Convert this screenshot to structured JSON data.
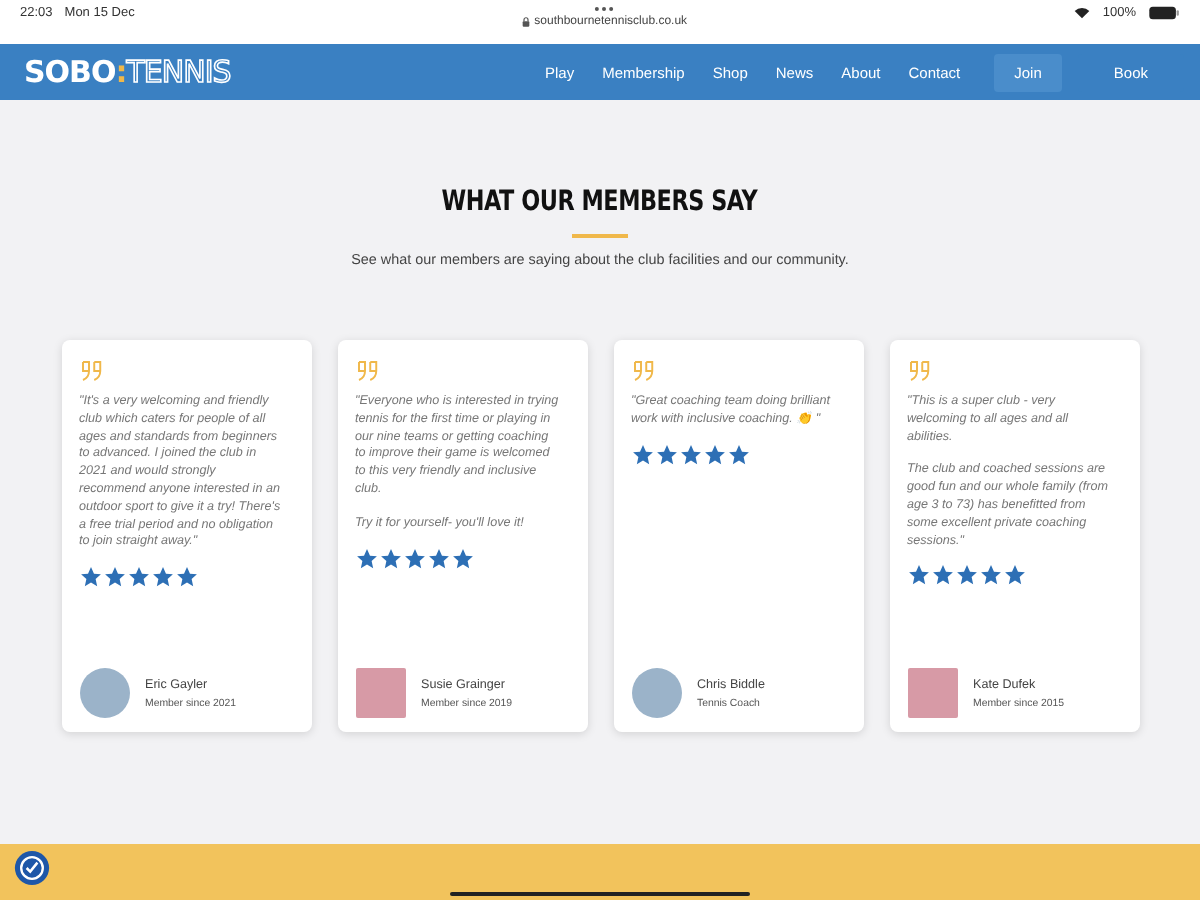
{
  "status_bar": {
    "time": "22:03",
    "date": "Mon 15 Dec",
    "url": "southbournetennisclub.co.uk",
    "battery": "100%"
  },
  "nav": {
    "logo": {
      "solid": "SOBO",
      "separator": ":",
      "outline": "TENNIS"
    },
    "links": [
      "Play",
      "Membership",
      "Shop",
      "News",
      "About",
      "Contact"
    ],
    "buttons": [
      {
        "label": "Join",
        "kind": "tinted"
      },
      {
        "label": "Book",
        "kind": "dark"
      }
    ]
  },
  "section": {
    "title": "WHAT OUR MEMBERS SAY",
    "subtitle": "See what our members are saying about the club facilities and our community."
  },
  "testimonials": [
    {
      "paragraphs": [
        "\"It's a very welcoming and friendly club which caters for people of all ages and standards from beginners to advanced. I joined the club in 2021 and would strongly recommend anyone interested in an outdoor sport to give it a try! There's a free trial period and no obligation to join straight away.\""
      ],
      "stars": 5,
      "name": "Eric Gayler",
      "role": "Member since 2021",
      "kind": "round"
    },
    {
      "paragraphs": [
        "\"Everyone who is interested in trying tennis for the first time or playing in our nine teams or getting coaching to improve their game is welcomed to this very friendly and inclusive club.",
        "Try it for yourself- you'll love it!"
      ],
      "stars": 5,
      "name": "Susie Grainger",
      "role": "Member since 2019",
      "kind": "square"
    },
    {
      "paragraphs": [
        "\"Great coaching team doing brilliant work with inclusive coaching. 👏 \""
      ],
      "stars": 5,
      "name": "Chris Biddle",
      "role": "Tennis Coach",
      "kind": "round"
    },
    {
      "paragraphs": [
        "\"This is a super club - very welcoming to all ages and all abilities.",
        "The club and coached sessions are good fun and our whole family (from age 3 to 73) has benefitted from some excellent private coaching sessions.\""
      ],
      "stars": 5,
      "name": "Kate Dufek",
      "role": "Member since 2015",
      "kind": "square"
    }
  ]
}
